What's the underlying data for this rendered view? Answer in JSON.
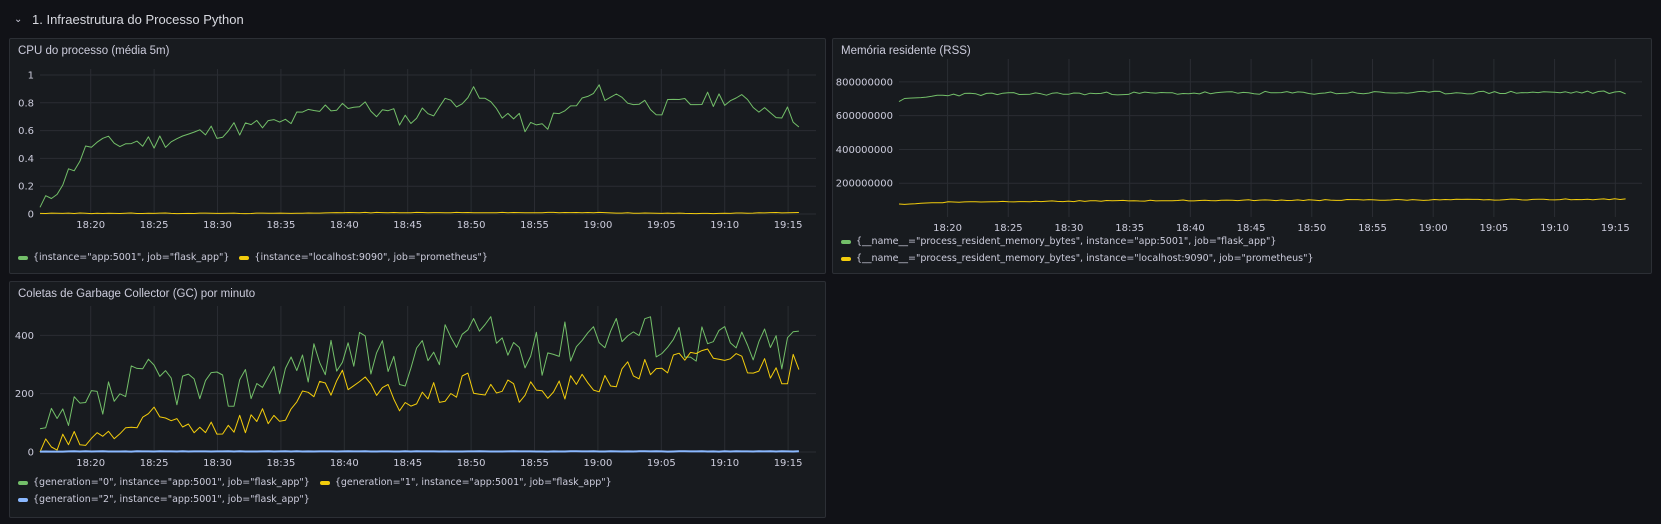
{
  "row": {
    "title": "1. Infraestrutura do Processo Python",
    "icon": "chevron-down"
  },
  "colors": {
    "green": "#73bf69",
    "yellow": "#f2cc0c",
    "blue": "#8ab8ff",
    "grid": "#2a2d33",
    "bg": "#181b1f"
  },
  "time_ticks": [
    "18:20",
    "18:25",
    "18:30",
    "18:35",
    "18:40",
    "18:45",
    "18:50",
    "18:55",
    "19:00",
    "19:05",
    "19:10",
    "19:15"
  ],
  "panels": {
    "cpu": {
      "title": "CPU do processo (média 5m)",
      "legend": [
        {
          "label": "{instance=\"app:5001\", job=\"flask_app\"}",
          "color": "#73bf69"
        },
        {
          "label": "{instance=\"localhost:9090\", job=\"prometheus\"}",
          "color": "#f2cc0c"
        }
      ]
    },
    "mem": {
      "title": "Memória residente (RSS)",
      "legend": [
        {
          "label": "{__name__=\"process_resident_memory_bytes\", instance=\"app:5001\", job=\"flask_app\"}",
          "color": "#73bf69"
        },
        {
          "label": "{__name__=\"process_resident_memory_bytes\", instance=\"localhost:9090\", job=\"prometheus\"}",
          "color": "#f2cc0c"
        }
      ]
    },
    "gc": {
      "title": "Coletas de Garbage Collector (GC) por minuto",
      "legend": [
        {
          "label": "{generation=\"0\", instance=\"app:5001\", job=\"flask_app\"}",
          "color": "#73bf69"
        },
        {
          "label": "{generation=\"1\", instance=\"app:5001\", job=\"flask_app\"}",
          "color": "#f2cc0c"
        },
        {
          "label": "{generation=\"2\", instance=\"app:5001\", job=\"flask_app\"}",
          "color": "#8ab8ff"
        }
      ]
    }
  },
  "chart_data": [
    {
      "type": "line",
      "title": "CPU do processo (média 5m)",
      "x": [
        "18:16",
        "18:20",
        "18:25",
        "18:30",
        "18:35",
        "18:40",
        "18:45",
        "18:50",
        "18:55",
        "19:00",
        "19:05",
        "19:10",
        "19:15",
        "19:16"
      ],
      "yticks": [
        "0",
        "0.2",
        "0.4",
        "0.6",
        "0.8",
        "1"
      ],
      "ylim": [
        0,
        1
      ],
      "series": [
        {
          "name": "{instance=\"app:5001\", job=\"flask_app\"}",
          "color": "#73bf69",
          "values": [
            0.03,
            0.5,
            0.52,
            0.6,
            0.65,
            0.8,
            0.68,
            0.87,
            0.6,
            0.88,
            0.76,
            0.84,
            0.72,
            0.67
          ]
        },
        {
          "name": "{instance=\"localhost:9090\", job=\"prometheus\"}",
          "color": "#f2cc0c",
          "values": [
            0.005,
            0.005,
            0.005,
            0.005,
            0.005,
            0.01,
            0.01,
            0.01,
            0.01,
            0.01,
            0.005,
            0.005,
            0.01,
            0.01
          ]
        }
      ]
    },
    {
      "type": "line",
      "title": "Memória residente (RSS)",
      "x": [
        "18:16",
        "18:20",
        "18:25",
        "18:30",
        "18:35",
        "18:40",
        "18:45",
        "18:50",
        "18:55",
        "19:00",
        "19:05",
        "19:10",
        "19:15",
        "19:16"
      ],
      "yticks": [
        "200000000",
        "400000000",
        "600000000",
        "800000000"
      ],
      "ylim": [
        0,
        900000000
      ],
      "series": [
        {
          "name": "{__name__=\"process_resident_memory_bytes\", instance=\"app:5001\", job=\"flask_app\"}",
          "color": "#73bf69",
          "values": [
            690000000,
            725000000,
            728000000,
            730000000,
            732000000,
            733000000,
            735000000,
            734000000,
            736000000,
            736000000,
            737000000,
            738000000,
            738000000,
            738000000
          ]
        },
        {
          "name": "{__name__=\"process_resident_memory_bytes\", instance=\"localhost:9090\", job=\"prometheus\"}",
          "color": "#f2cc0c",
          "values": [
            75000000,
            88000000,
            92000000,
            94000000,
            96000000,
            98000000,
            99000000,
            100000000,
            101000000,
            101000000,
            103000000,
            104000000,
            106000000,
            106000000
          ]
        }
      ]
    },
    {
      "type": "line",
      "title": "Coletas de Garbage Collector (GC) por minuto",
      "x": [
        "18:16",
        "18:20",
        "18:25",
        "18:30",
        "18:35",
        "18:40",
        "18:45",
        "18:50",
        "18:55",
        "19:00",
        "19:05",
        "19:10",
        "19:15",
        "19:16"
      ],
      "yticks": [
        "0",
        "200",
        "400"
      ],
      "ylim": [
        0,
        480
      ],
      "series": [
        {
          "name": "{generation=\"0\", instance=\"app:5001\", job=\"flask_app\"}",
          "color": "#73bf69",
          "values": [
            50,
            150,
            260,
            200,
            280,
            340,
            300,
            420,
            330,
            430,
            400,
            370,
            350,
            430
          ]
        },
        {
          "name": "{generation=\"1\", instance=\"app:5001\", job=\"flask_app\"}",
          "color": "#f2cc0c",
          "values": [
            10,
            40,
            110,
            90,
            130,
            240,
            170,
            230,
            200,
            240,
            300,
            330,
            270,
            320
          ]
        },
        {
          "name": "{generation=\"2\", instance=\"app:5001\", job=\"flask_app\"}",
          "color": "#8ab8ff",
          "values": [
            2,
            2,
            2,
            2,
            2,
            2,
            2,
            2,
            2,
            2,
            2,
            2,
            2,
            2
          ]
        }
      ]
    }
  ]
}
